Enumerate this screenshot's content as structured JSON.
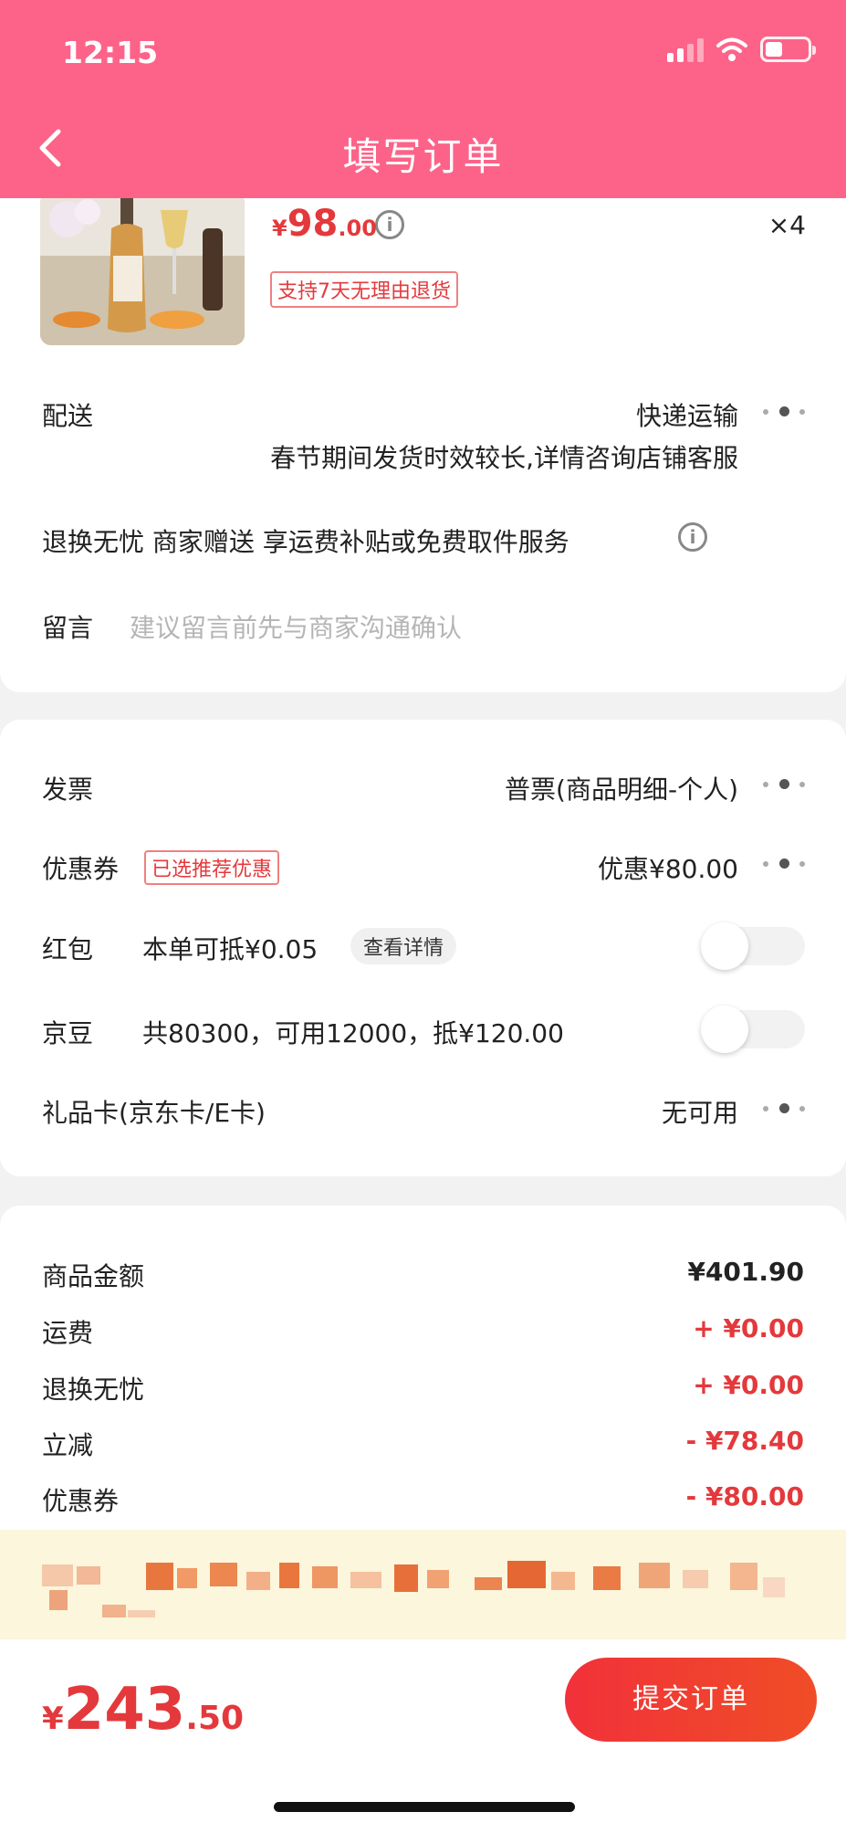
{
  "status": {
    "time": "12:15"
  },
  "header": {
    "title": "填写订单"
  },
  "product": {
    "price_yen": "¥",
    "price_int": "98",
    "price_dec": ".00",
    "qty": "×4",
    "return_tag": "支持7天无理由退货"
  },
  "delivery": {
    "label": "配送",
    "method": "快递运输",
    "note": "春节期间发货时效较长,详情咨询店铺客服"
  },
  "service": {
    "text": "退换无忧 商家赠送 享运费补贴或免费取件服务"
  },
  "message": {
    "label": "留言",
    "placeholder": "建议留言前先与商家沟通确认"
  },
  "invoice": {
    "label": "发票",
    "value": "普票(商品明细-个人)"
  },
  "coupon": {
    "label": "优惠券",
    "tag": "已选推荐优惠",
    "value": "优惠¥80.00"
  },
  "red_packet": {
    "label": "红包",
    "desc": "本单可抵¥0.05",
    "detail_btn": "查看详情",
    "enabled": false
  },
  "jd_beans": {
    "label": "京豆",
    "desc": "共80300，可用12000，抵¥120.00",
    "enabled": false
  },
  "gift_card": {
    "label": "礼品卡(京东卡/E卡)",
    "value": "无可用"
  },
  "amounts": [
    {
      "label": "商品金额",
      "value": "¥401.90",
      "red": false
    },
    {
      "label": "运费",
      "value": "+ ¥0.00",
      "red": true
    },
    {
      "label": "退换无忧",
      "value": "+ ¥0.00",
      "red": true
    },
    {
      "label": "立减",
      "value": "- ¥78.40",
      "red": true
    },
    {
      "label": "优惠券",
      "value": "- ¥80.00",
      "red": true
    }
  ],
  "bottom": {
    "total_yen": "¥",
    "total_int": "243",
    "total_dec": ".50",
    "submit_label": "提交订单"
  },
  "colors": {
    "header": "#fd6389",
    "accent_red": "#e4393c",
    "notice_bg": "#fbf6dc"
  },
  "icons": [
    "back-chevron-icon",
    "signal-icon",
    "wifi-icon",
    "battery-icon",
    "info-icon",
    "more-dots-icon"
  ]
}
